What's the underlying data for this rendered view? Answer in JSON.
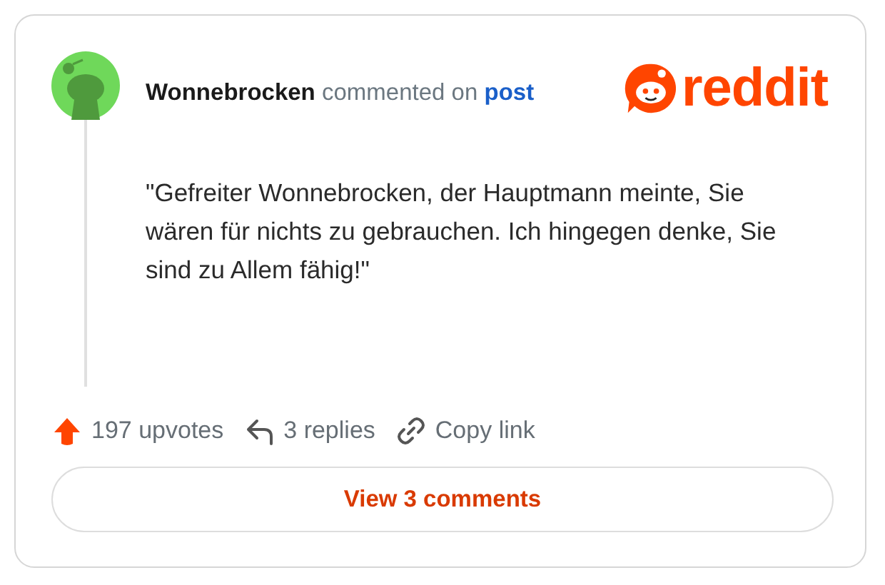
{
  "header": {
    "author": "Wonnebrocken",
    "action": "commented on",
    "link": "post",
    "brand": "reddit"
  },
  "comment": {
    "text": "\"Gefreiter Wonnebrocken, der Hauptmann meinte, Sie wären für nichts zu gebrauchen. Ich hingegen denke, Sie sind zu Allem fähig!\""
  },
  "actions": [
    {
      "kind": "upvote",
      "label": "197 upvotes"
    },
    {
      "kind": "reply",
      "label": "3 replies"
    },
    {
      "kind": "link",
      "label": "Copy link"
    }
  ],
  "button": {
    "label": "View 3 comments"
  }
}
